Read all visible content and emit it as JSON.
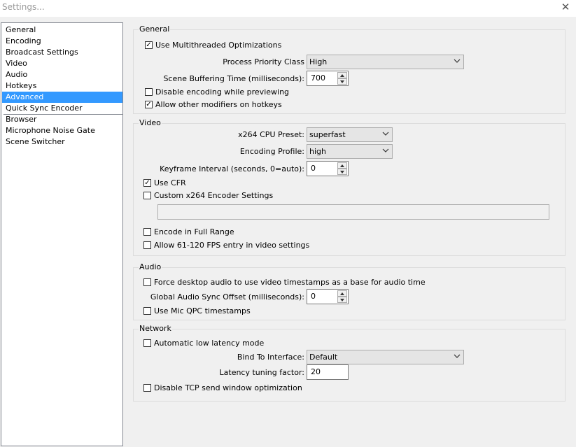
{
  "window": {
    "title": "Settings...",
    "close_glyph": "✕"
  },
  "nav": {
    "items": [
      {
        "label": "General"
      },
      {
        "label": "Encoding"
      },
      {
        "label": "Broadcast Settings"
      },
      {
        "label": "Video"
      },
      {
        "label": "Audio"
      },
      {
        "label": "Hotkeys"
      },
      {
        "label": "Advanced",
        "selected": true
      },
      {
        "label": "Quick Sync Encoder"
      },
      {
        "label": "Browser"
      },
      {
        "label": "Microphone Noise Gate"
      },
      {
        "label": "Scene Switcher"
      }
    ]
  },
  "general": {
    "title": "General",
    "multithreaded": {
      "label": "Use Multithreaded Optimizations",
      "checked": true
    },
    "priority": {
      "label": "Process Priority Class",
      "value": "High"
    },
    "buffering": {
      "label": "Scene Buffering Time (milliseconds):",
      "value": "700"
    },
    "disable_preview": {
      "label": "Disable encoding while previewing",
      "checked": false
    },
    "modifiers": {
      "label": "Allow other modifiers on hotkeys",
      "checked": true
    }
  },
  "video": {
    "title": "Video",
    "preset": {
      "label": "x264 CPU Preset:",
      "value": "superfast"
    },
    "profile": {
      "label": "Encoding Profile:",
      "value": "high"
    },
    "keyframe": {
      "label": "Keyframe Interval (seconds, 0=auto):",
      "value": "0"
    },
    "cfr": {
      "label": "Use CFR",
      "checked": true
    },
    "custom": {
      "label": "Custom x264 Encoder Settings",
      "checked": false,
      "value": ""
    },
    "full_range": {
      "label": "Encode in Full Range",
      "checked": false
    },
    "fps_entry": {
      "label": "Allow 61-120 FPS entry in video settings",
      "checked": false
    }
  },
  "audio": {
    "title": "Audio",
    "force_desktop": {
      "label": "Force desktop audio to use video timestamps as a base for audio time",
      "checked": false
    },
    "sync_offset": {
      "label": "Global Audio Sync Offset (milliseconds):",
      "value": "0"
    },
    "mic_qpc": {
      "label": "Use Mic QPC timestamps",
      "checked": false
    }
  },
  "network": {
    "title": "Network",
    "low_latency": {
      "label": "Automatic low latency mode",
      "checked": false
    },
    "bind": {
      "label": "Bind To Interface:",
      "value": "Default"
    },
    "latency_factor": {
      "label": "Latency tuning factor:",
      "value": "20"
    },
    "tcp_opt": {
      "label": "Disable TCP send window optimization",
      "checked": false
    }
  },
  "colors": {
    "selection": "#3399ff",
    "panel": "#f0f0f0",
    "group_border": "#dcdcdc"
  },
  "icons": {
    "close": "close-icon",
    "combo": "chevron-down-icon",
    "spin_up": "spin-up-icon",
    "spin_down": "spin-down-icon"
  }
}
